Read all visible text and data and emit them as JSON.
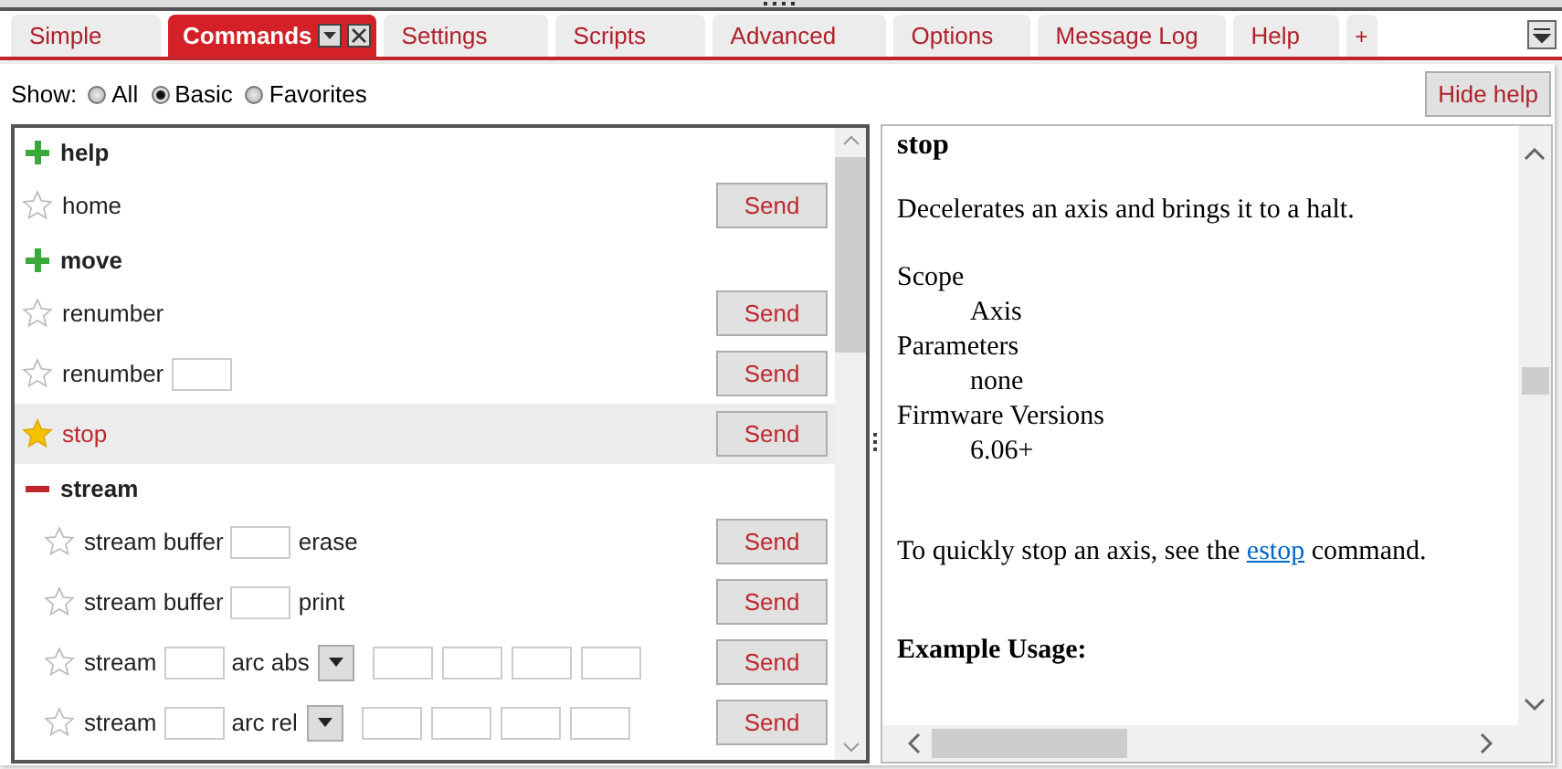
{
  "tabs": [
    {
      "label": "Simple",
      "selected": false
    },
    {
      "label": "Commands",
      "selected": true
    },
    {
      "label": "Settings",
      "selected": false
    },
    {
      "label": "Scripts",
      "selected": false
    },
    {
      "label": "Advanced",
      "selected": false
    },
    {
      "label": "Options",
      "selected": false
    },
    {
      "label": "Message Log",
      "selected": false
    },
    {
      "label": "Help",
      "selected": false
    },
    {
      "label": "+",
      "selected": false
    }
  ],
  "show": {
    "label": "Show:",
    "options": [
      {
        "label": "All",
        "selected": false
      },
      {
        "label": "Basic",
        "selected": true
      },
      {
        "label": "Favorites",
        "selected": false
      }
    ]
  },
  "hide_help_button": "Hide help",
  "commands": [
    {
      "kind": "group",
      "name": "help",
      "expanded": false
    },
    {
      "kind": "command",
      "favorite": false,
      "selected": false,
      "parts": [
        {
          "kind": "text",
          "text": "home"
        }
      ],
      "button": "Send"
    },
    {
      "kind": "group",
      "name": "move",
      "expanded": false
    },
    {
      "kind": "command",
      "favorite": false,
      "selected": false,
      "parts": [
        {
          "kind": "text",
          "text": "renumber"
        }
      ],
      "button": "Send"
    },
    {
      "kind": "command",
      "favorite": false,
      "selected": false,
      "parts": [
        {
          "kind": "text",
          "text": "renumber"
        },
        {
          "kind": "field"
        }
      ],
      "button": "Send"
    },
    {
      "kind": "command",
      "favorite": true,
      "selected": true,
      "parts": [
        {
          "kind": "text",
          "text": "stop"
        }
      ],
      "button": "Send"
    },
    {
      "kind": "group",
      "name": "stream",
      "expanded": true,
      "children": [
        {
          "kind": "command",
          "favorite": false,
          "selected": false,
          "parts": [
            {
              "kind": "text",
              "text": "stream buffer"
            },
            {
              "kind": "field"
            },
            {
              "kind": "text",
              "text": "erase"
            }
          ],
          "button": "Send"
        },
        {
          "kind": "command",
          "favorite": false,
          "selected": false,
          "parts": [
            {
              "kind": "text",
              "text": "stream buffer"
            },
            {
              "kind": "field"
            },
            {
              "kind": "text",
              "text": "print"
            }
          ],
          "button": "Send"
        },
        {
          "kind": "command",
          "favorite": false,
          "selected": false,
          "parts": [
            {
              "kind": "text",
              "text": "stream"
            },
            {
              "kind": "field"
            },
            {
              "kind": "text",
              "text": "arc abs"
            },
            {
              "kind": "dropdown"
            },
            {
              "kind": "field"
            },
            {
              "kind": "field"
            },
            {
              "kind": "field"
            },
            {
              "kind": "field"
            }
          ],
          "button": "Send"
        },
        {
          "kind": "command",
          "favorite": false,
          "selected": false,
          "parts": [
            {
              "kind": "text",
              "text": "stream"
            },
            {
              "kind": "field"
            },
            {
              "kind": "text",
              "text": "arc rel"
            },
            {
              "kind": "dropdown"
            },
            {
              "kind": "field"
            },
            {
              "kind": "field"
            },
            {
              "kind": "field"
            },
            {
              "kind": "field"
            }
          ],
          "button": "Send"
        }
      ]
    }
  ],
  "help": {
    "title": "stop",
    "description": "Decelerates an axis and brings it to a halt.",
    "sections": [
      {
        "label": "Scope",
        "value": "Axis"
      },
      {
        "label": "Parameters",
        "value": "none"
      },
      {
        "label": "Firmware Versions",
        "value": "6.06+"
      }
    ],
    "note_before": "To quickly stop an axis, see the",
    "note_link": "estop",
    "note_after": "command.",
    "example_heading": "Example Usage:"
  }
}
